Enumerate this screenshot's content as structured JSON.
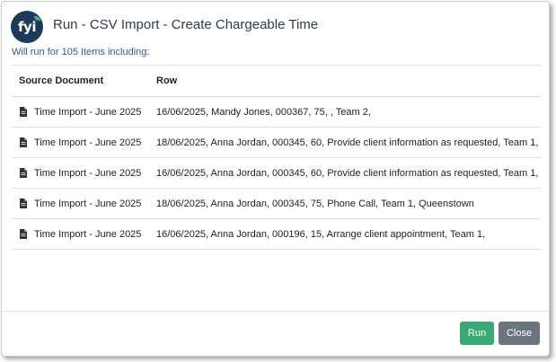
{
  "dialog": {
    "title": "Run - CSV Import - Create Chargeable Time",
    "subtitle": "Will run for 105 Items including:",
    "logo_text": "fyi"
  },
  "table": {
    "headers": [
      "Source Document",
      "Row"
    ],
    "rows": [
      {
        "source": "Time Import - June 2025",
        "row": "16/06/2025, Mandy Jones, 000367, 75, , Team 2,"
      },
      {
        "source": "Time Import - June 2025",
        "row": "18/06/2025, Anna Jordan, 000345, 60, Provide client information as requested, Team 1,"
      },
      {
        "source": "Time Import - June 2025",
        "row": "16/06/2025, Anna Jordan, 000345, 60, Provide client information as requested, Team 1,"
      },
      {
        "source": "Time Import - June 2025",
        "row": "18/06/2025, Anna Jordan, 000345, 75, Phone Call, Team 1, Queenstown"
      },
      {
        "source": "Time Import - June 2025",
        "row": "16/06/2025, Anna Jordan, 000196, 15, Arrange client appointment, Team 1,"
      }
    ]
  },
  "buttons": {
    "run_label": "Run",
    "close_label": "Close"
  },
  "colors": {
    "run": "#3aaa74",
    "close": "#6c757d",
    "logo_bg": "#1e3a5a",
    "title": "#2f3a4a",
    "subtitle": "#2f5f8a"
  },
  "icons": {
    "logo": "fyi-logo-icon",
    "document": "document-icon"
  }
}
